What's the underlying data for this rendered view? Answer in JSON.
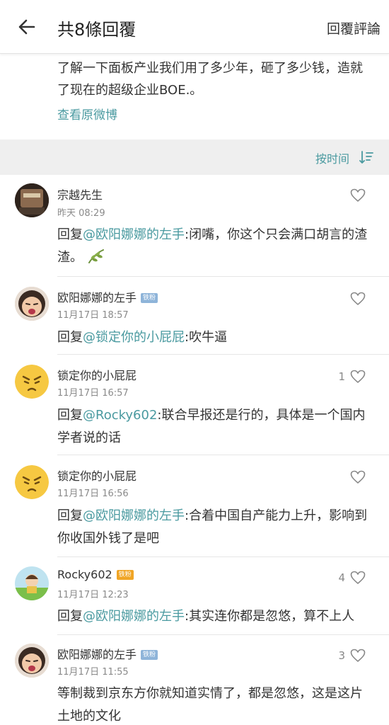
{
  "header": {
    "title": "共8條回覆",
    "action": "回覆評論"
  },
  "original": {
    "text": "了解一下面板产业我们用了多少年，砸了多少钱，造就了现在的超级企业BOE.。",
    "link": "查看原微博"
  },
  "sort": {
    "label": "按时间"
  },
  "comments": [
    {
      "user": "宗越先生",
      "time": "昨天 08:29",
      "reply_prefix": "回复",
      "mention": "@欧阳娜娜的左手",
      "text": ":闭嘴，你这个只会满口胡言的渣渣。",
      "emoji": "leaf-icon"
    },
    {
      "user": "欧阳娜娜的左手",
      "badge": "铁粉",
      "time": "11月17日 18:57",
      "reply_prefix": "回复",
      "mention": "@锁定你的小屁屁",
      "text": ":吹牛逼"
    },
    {
      "user": "锁定你的小屁屁",
      "time": "11月17日 16:57",
      "likes": "1",
      "reply_prefix": "回复",
      "mention": "@Rocky602",
      "text": ":联合早报还是行的，具体是一个国内学者说的话"
    },
    {
      "user": "锁定你的小屁屁",
      "time": "11月17日 16:56",
      "reply_prefix": "回复",
      "mention": "@欧阳娜娜的左手",
      "text": ":合着中国自产能力上升，影响到你收国外钱了是吧"
    },
    {
      "user": "Rocky602",
      "badge": "铁粉",
      "time": "11月17日 12:23",
      "likes": "4",
      "reply_prefix": "回复",
      "mention": "@欧阳娜娜的左手",
      "text": ":其实连你都是忽悠，算不上人"
    },
    {
      "user": "欧阳娜娜的左手",
      "badge": "铁粉",
      "time": "11月17日 11:55",
      "likes": "3",
      "text": "等制裁到京东方你就知道实情了，都是忽悠，这是这片土地的文化"
    }
  ],
  "colors": {
    "link": "#4a9aa0",
    "badge": "#8eb4d9",
    "badge_gold": "#f0a526",
    "sort_bar": "#efefef"
  }
}
